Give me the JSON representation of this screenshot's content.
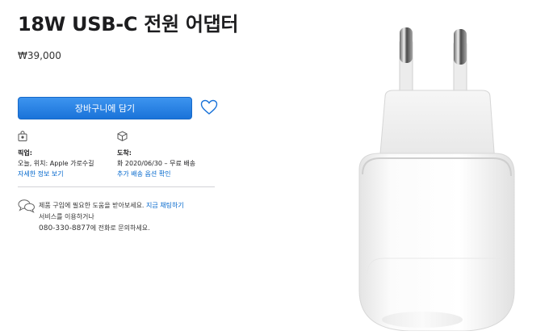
{
  "product": {
    "title": "18W USB-C 전원 어댑터",
    "price": "₩39,000"
  },
  "actions": {
    "add_to_bag": "장바구니에 담기",
    "favorite_icon": "heart-icon"
  },
  "pickup": {
    "icon": "bag-icon",
    "label": "픽업:",
    "line1": "오늘, 위치: Apple 가로수길",
    "link": "자세한 정보 보기"
  },
  "delivery": {
    "icon": "box-icon",
    "label": "도착:",
    "line1": "화 2020/06/30 – 무료 배송",
    "link": "추가 배송 옵션 확인"
  },
  "help": {
    "icon": "chat-bubbles-icon",
    "line1": "제품 구입에 필요한 도움을 받아보세요.",
    "chat_link": "지금 채팅하기",
    "line2": "서비스를 이용하거나",
    "phone": "080-330-8877",
    "line3": "에 전화로 문의하세요."
  },
  "colors": {
    "button": "#1a73d9",
    "link": "#0066cc",
    "text": "#1d1d1f"
  }
}
